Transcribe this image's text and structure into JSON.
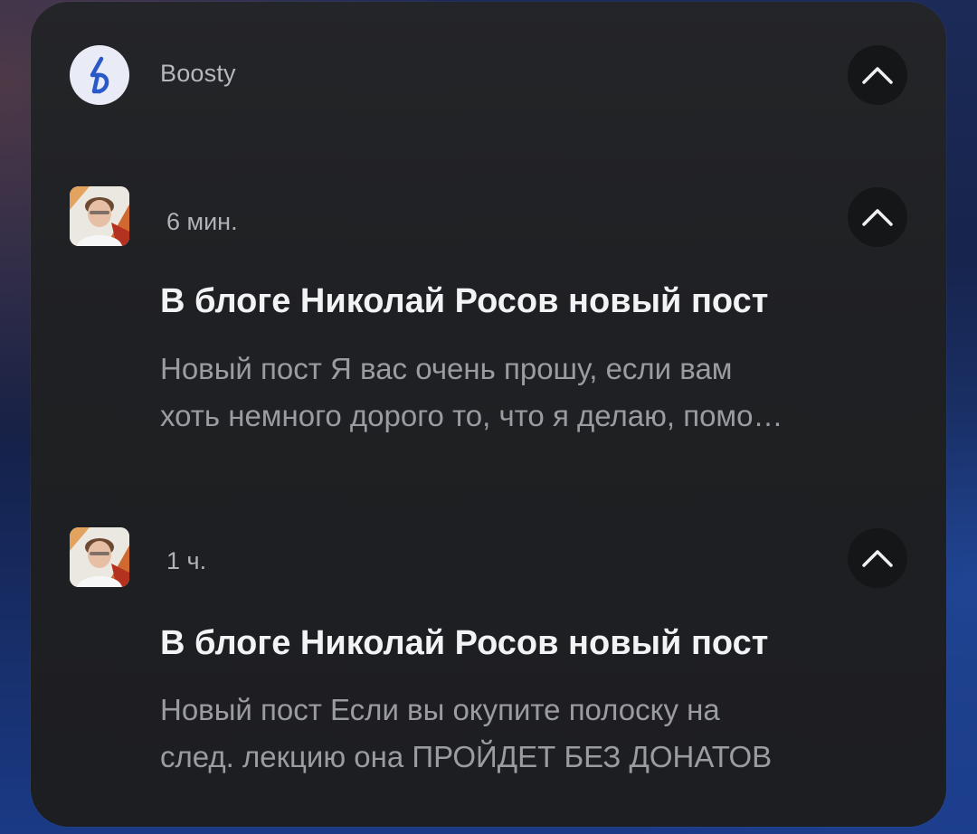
{
  "app": {
    "name": "Boosty",
    "icon": "boosty-logo-icon",
    "collapse_icon": "chevron-up-icon"
  },
  "notifications": [
    {
      "time": "6 мин.",
      "title": "В блоге Николай Росов новый пост",
      "body_line1": "Новый пост Я вас очень прошу, если вам",
      "body_line2": "хоть немного дорого то, что я делаю, помо…",
      "avatar_icon": "avatar-icon",
      "collapse_icon": "chevron-up-icon"
    },
    {
      "time": "1 ч.",
      "title": "В блоге Николай Росов новый пост",
      "body_line1": "Новый пост Если вы окупите полоску на",
      "body_line2": "след. лекцию она ПРОЙДЕТ БЕЗ ДОНАТОВ",
      "avatar_icon": "avatar-icon",
      "collapse_icon": "chevron-up-icon"
    }
  ],
  "colors": {
    "panel": "#1f2023",
    "title": "#f2f3f5",
    "body": "#9a9ca2",
    "accent_blue": "#2a58c9"
  }
}
